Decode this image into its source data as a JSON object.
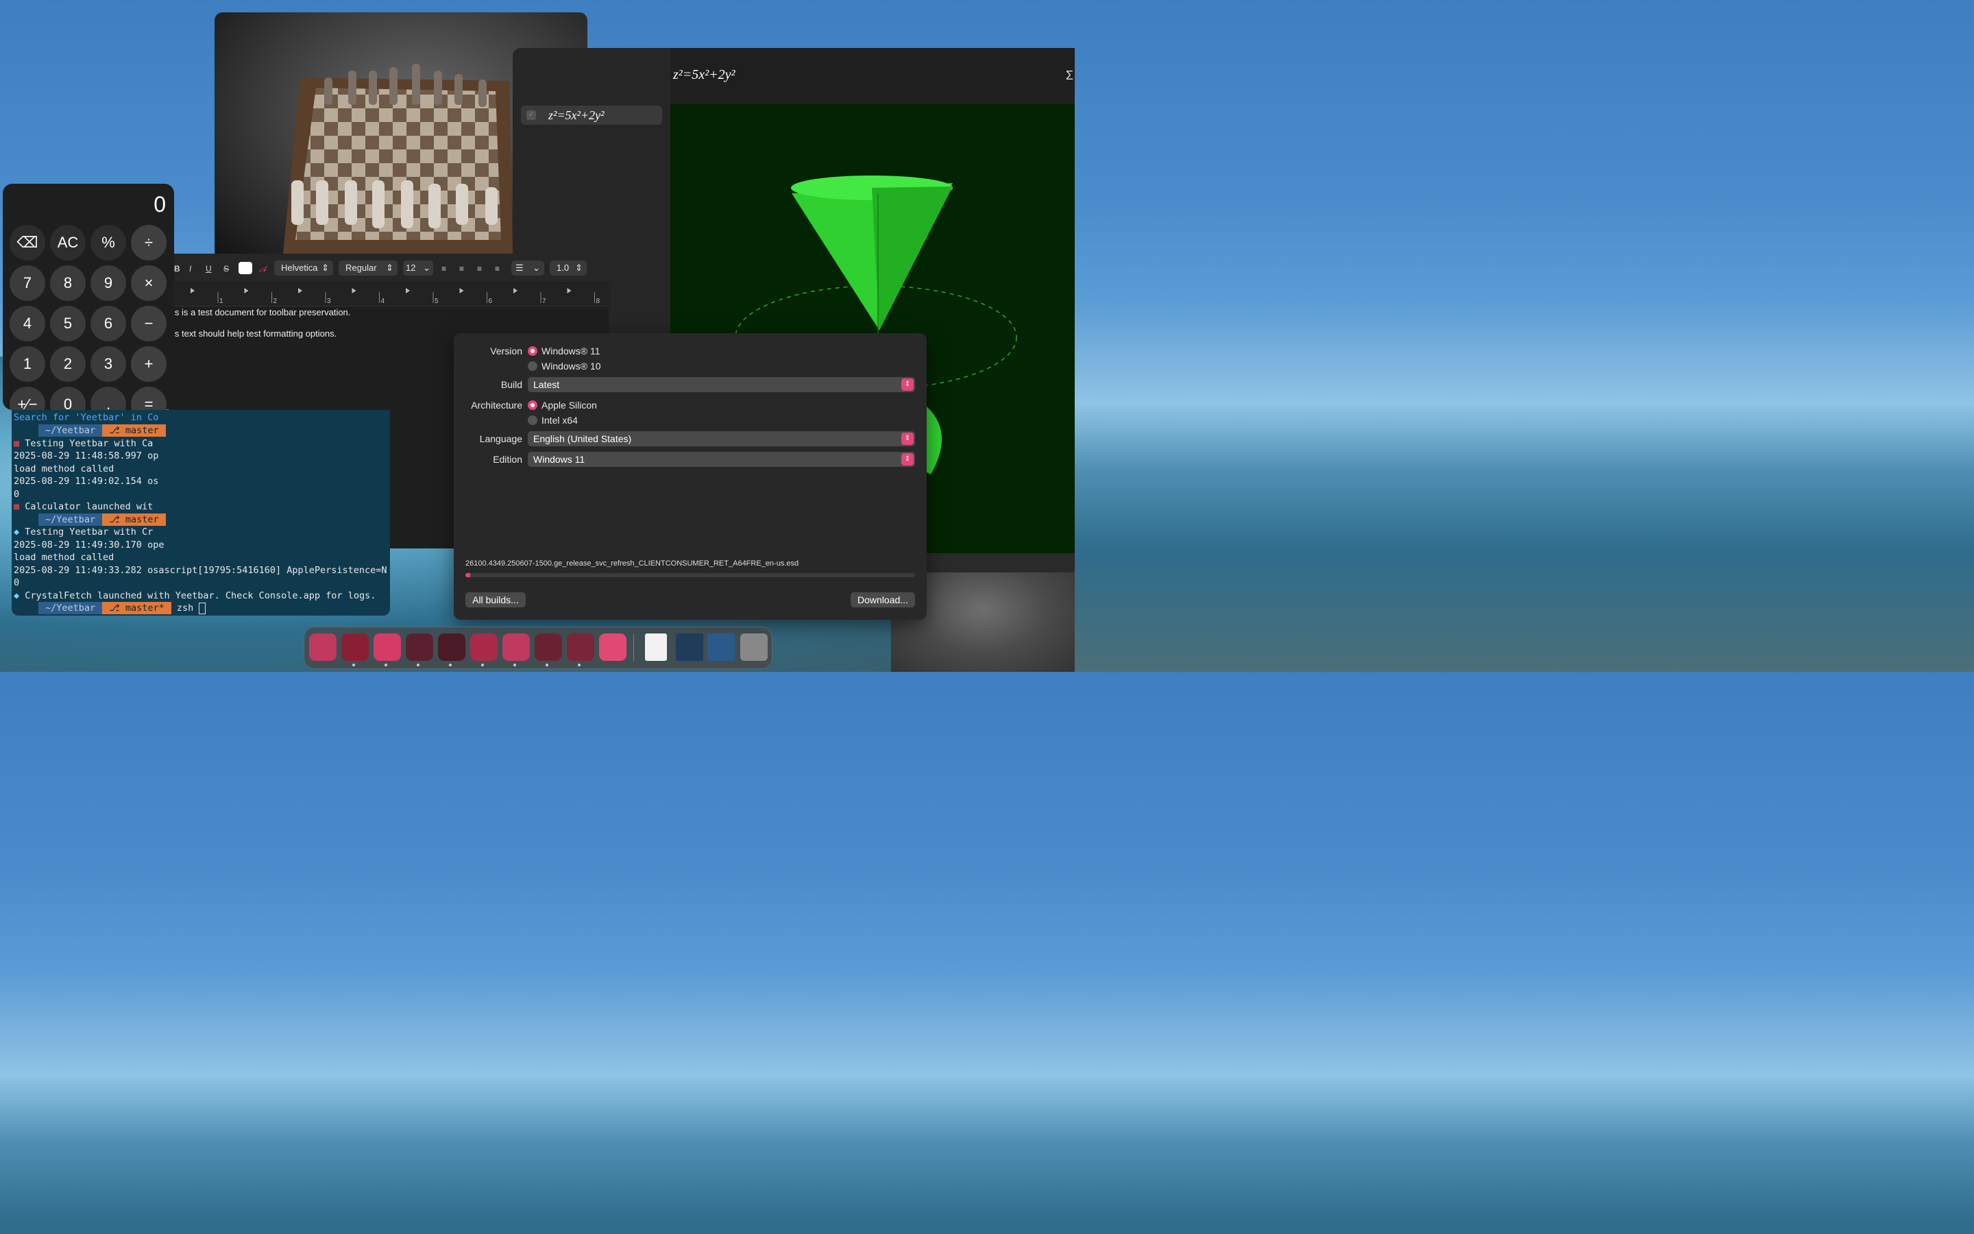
{
  "calculator": {
    "display": "0",
    "buttons": [
      [
        "⌫",
        "AC",
        "%",
        "÷"
      ],
      [
        "7",
        "8",
        "9",
        "×"
      ],
      [
        "4",
        "5",
        "6",
        "−"
      ],
      [
        "1",
        "2",
        "3",
        "+"
      ],
      [
        "+∕−",
        "0",
        ".",
        "="
      ]
    ]
  },
  "grapher": {
    "sidebar_equation": "z²=5x²+2y²",
    "header_equation": "z²=5x²+2y²",
    "header_icon": "Σ",
    "plot_color": "#33e033"
  },
  "textedit": {
    "font": "Helvetica",
    "style": "Regular",
    "size": "12",
    "line_spacing": "1.0",
    "ruler_numbers": [
      "1",
      "2",
      "3",
      "4",
      "5",
      "6",
      "7",
      "8"
    ],
    "lines": [
      "is is a test document for toolbar preservation.",
      "is text should help test formatting options."
    ]
  },
  "terminal": {
    "search_line": "Search for 'Yeetbar' in Co",
    "prompt_dir": "~/Yeetbar",
    "prompt_branch": "⎇ master",
    "prompt_branch_dirty": "⎇ master*",
    "lines": [
      "Testing Yeetbar with Ca",
      "2025-08-29 11:48:58.997 op",
      "load method called",
      "2025-08-29 11:49:02.154 os",
      "0",
      "Calculator launched wit",
      "Testing Yeetbar with Cr",
      "2025-08-29 11:49:30.170 ope",
      "load method called",
      "2025-08-29 11:49:33.282 osascript[19795:5416160] ApplePersistence=N",
      "0",
      "CrystalFetch launched with Yeetbar. Check Console.app for logs."
    ],
    "command": "zsh"
  },
  "crystalfetch": {
    "version_label": "Version",
    "version_options": [
      "Windows® 11",
      "Windows® 10"
    ],
    "build_label": "Build",
    "build_value": "Latest",
    "architecture_label": "Architecture",
    "architecture_options": [
      "Apple Silicon",
      "Intel x64"
    ],
    "language_label": "Language",
    "language_value": "English (United States)",
    "edition_label": "Edition",
    "edition_value": "Windows 11",
    "file_name": "26100.4349.250607-1500.ge_release_svc_refresh_CLIENTCONSUMER_RET_A64FRE_en-us.esd",
    "progress": 0.01,
    "all_builds_button": "All builds...",
    "download_button": "Download...",
    "accent": "#e2467c"
  },
  "dock": {
    "apps": [
      "finder-icon",
      "affinity-icon",
      "yeetbar-icon",
      "settings-icon",
      "console-icon",
      "app-icon",
      "ribbon-icon",
      "spreadsheet-icon",
      "calculator-icon",
      "gem-icon"
    ],
    "recent": [
      "document-icon",
      "screenshot-icon",
      "screenshot-icon-2"
    ],
    "trash": "trash-icon"
  }
}
